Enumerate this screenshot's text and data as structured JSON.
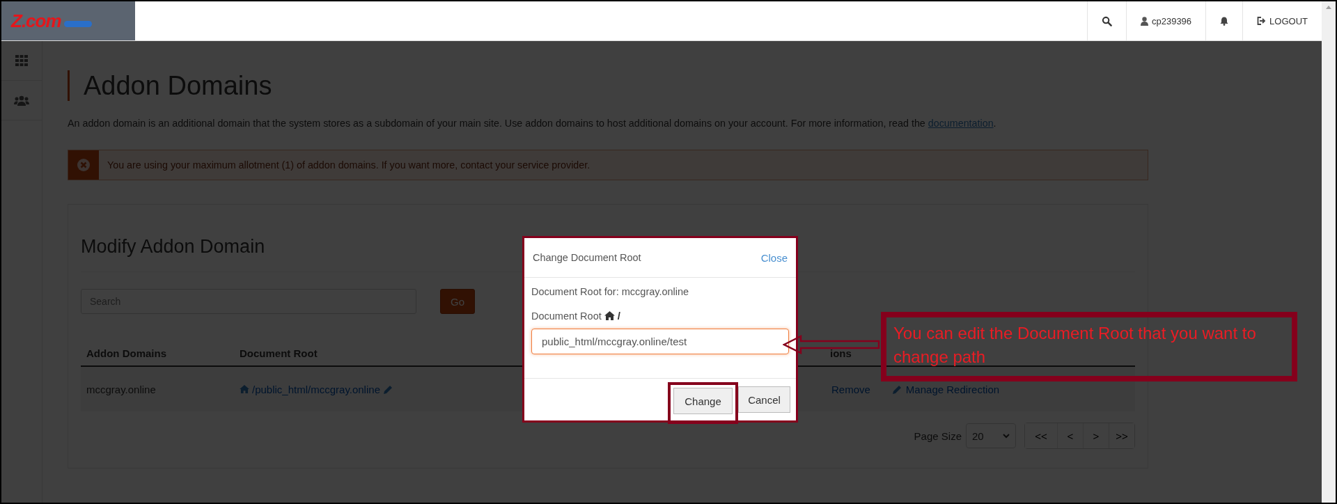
{
  "top_bar": {
    "logo": "Z.com",
    "user": "cp239396",
    "logout": "LOGOUT"
  },
  "page": {
    "title": "Addon Domains",
    "description": "An addon domain is an additional domain that the system stores as a subdomain of your main site. Use addon domains to host additional domains on your account. For more information, read the ",
    "link": "documentation",
    "description_end": "."
  },
  "alert": {
    "text": "You are using your maximum allotment (1) of addon domains. If you want more, contact your service provider."
  },
  "card": {
    "title": "Modify Addon Domain",
    "search": {
      "placeholder": "Search"
    },
    "go": "Go",
    "table": {
      "columns": [
        "Addon Domains",
        "Document Root",
        "ions"
      ],
      "rows": [
        {
          "domain": "mccgray.online",
          "document_root": "/public_html/mccgray.online",
          "actions": [
            "Remove",
            "Manage Redirection"
          ]
        }
      ]
    },
    "pagination": {
      "label": "Page Size",
      "page_size": "20",
      "buttons": [
        "<<",
        "<",
        ">",
        ">>"
      ]
    }
  },
  "modal": {
    "title": "Change Document Root",
    "close": "Close",
    "for_label": "Document Root for: mccgray.online",
    "root_label": "Document Root",
    "root_suffix": "/",
    "value": "public_html/mccgray.online/test",
    "buttons": [
      {
        "label": "Change",
        "highlighted": true
      },
      {
        "label": "Cancel",
        "highlighted": false
      }
    ]
  },
  "annotation": {
    "text": "You can edit the Document Root that you want to change path"
  }
}
